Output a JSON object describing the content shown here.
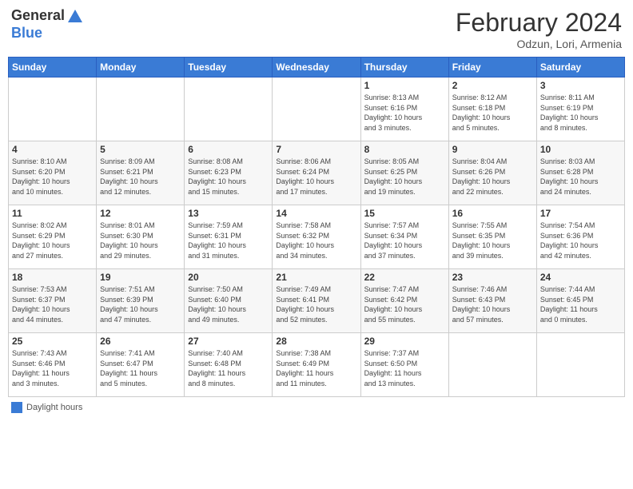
{
  "header": {
    "logo_general": "General",
    "logo_blue": "Blue",
    "title": "February 2024",
    "subtitle": "Odzun, Lori, Armenia"
  },
  "legend": {
    "box_label": "Daylight hours"
  },
  "days_of_week": [
    "Sunday",
    "Monday",
    "Tuesday",
    "Wednesday",
    "Thursday",
    "Friday",
    "Saturday"
  ],
  "weeks": [
    [
      {
        "day": "",
        "info": ""
      },
      {
        "day": "",
        "info": ""
      },
      {
        "day": "",
        "info": ""
      },
      {
        "day": "",
        "info": ""
      },
      {
        "day": "1",
        "info": "Sunrise: 8:13 AM\nSunset: 6:16 PM\nDaylight: 10 hours\nand 3 minutes."
      },
      {
        "day": "2",
        "info": "Sunrise: 8:12 AM\nSunset: 6:18 PM\nDaylight: 10 hours\nand 5 minutes."
      },
      {
        "day": "3",
        "info": "Sunrise: 8:11 AM\nSunset: 6:19 PM\nDaylight: 10 hours\nand 8 minutes."
      }
    ],
    [
      {
        "day": "4",
        "info": "Sunrise: 8:10 AM\nSunset: 6:20 PM\nDaylight: 10 hours\nand 10 minutes."
      },
      {
        "day": "5",
        "info": "Sunrise: 8:09 AM\nSunset: 6:21 PM\nDaylight: 10 hours\nand 12 minutes."
      },
      {
        "day": "6",
        "info": "Sunrise: 8:08 AM\nSunset: 6:23 PM\nDaylight: 10 hours\nand 15 minutes."
      },
      {
        "day": "7",
        "info": "Sunrise: 8:06 AM\nSunset: 6:24 PM\nDaylight: 10 hours\nand 17 minutes."
      },
      {
        "day": "8",
        "info": "Sunrise: 8:05 AM\nSunset: 6:25 PM\nDaylight: 10 hours\nand 19 minutes."
      },
      {
        "day": "9",
        "info": "Sunrise: 8:04 AM\nSunset: 6:26 PM\nDaylight: 10 hours\nand 22 minutes."
      },
      {
        "day": "10",
        "info": "Sunrise: 8:03 AM\nSunset: 6:28 PM\nDaylight: 10 hours\nand 24 minutes."
      }
    ],
    [
      {
        "day": "11",
        "info": "Sunrise: 8:02 AM\nSunset: 6:29 PM\nDaylight: 10 hours\nand 27 minutes."
      },
      {
        "day": "12",
        "info": "Sunrise: 8:01 AM\nSunset: 6:30 PM\nDaylight: 10 hours\nand 29 minutes."
      },
      {
        "day": "13",
        "info": "Sunrise: 7:59 AM\nSunset: 6:31 PM\nDaylight: 10 hours\nand 31 minutes."
      },
      {
        "day": "14",
        "info": "Sunrise: 7:58 AM\nSunset: 6:32 PM\nDaylight: 10 hours\nand 34 minutes."
      },
      {
        "day": "15",
        "info": "Sunrise: 7:57 AM\nSunset: 6:34 PM\nDaylight: 10 hours\nand 37 minutes."
      },
      {
        "day": "16",
        "info": "Sunrise: 7:55 AM\nSunset: 6:35 PM\nDaylight: 10 hours\nand 39 minutes."
      },
      {
        "day": "17",
        "info": "Sunrise: 7:54 AM\nSunset: 6:36 PM\nDaylight: 10 hours\nand 42 minutes."
      }
    ],
    [
      {
        "day": "18",
        "info": "Sunrise: 7:53 AM\nSunset: 6:37 PM\nDaylight: 10 hours\nand 44 minutes."
      },
      {
        "day": "19",
        "info": "Sunrise: 7:51 AM\nSunset: 6:39 PM\nDaylight: 10 hours\nand 47 minutes."
      },
      {
        "day": "20",
        "info": "Sunrise: 7:50 AM\nSunset: 6:40 PM\nDaylight: 10 hours\nand 49 minutes."
      },
      {
        "day": "21",
        "info": "Sunrise: 7:49 AM\nSunset: 6:41 PM\nDaylight: 10 hours\nand 52 minutes."
      },
      {
        "day": "22",
        "info": "Sunrise: 7:47 AM\nSunset: 6:42 PM\nDaylight: 10 hours\nand 55 minutes."
      },
      {
        "day": "23",
        "info": "Sunrise: 7:46 AM\nSunset: 6:43 PM\nDaylight: 10 hours\nand 57 minutes."
      },
      {
        "day": "24",
        "info": "Sunrise: 7:44 AM\nSunset: 6:45 PM\nDaylight: 11 hours\nand 0 minutes."
      }
    ],
    [
      {
        "day": "25",
        "info": "Sunrise: 7:43 AM\nSunset: 6:46 PM\nDaylight: 11 hours\nand 3 minutes."
      },
      {
        "day": "26",
        "info": "Sunrise: 7:41 AM\nSunset: 6:47 PM\nDaylight: 11 hours\nand 5 minutes."
      },
      {
        "day": "27",
        "info": "Sunrise: 7:40 AM\nSunset: 6:48 PM\nDaylight: 11 hours\nand 8 minutes."
      },
      {
        "day": "28",
        "info": "Sunrise: 7:38 AM\nSunset: 6:49 PM\nDaylight: 11 hours\nand 11 minutes."
      },
      {
        "day": "29",
        "info": "Sunrise: 7:37 AM\nSunset: 6:50 PM\nDaylight: 11 hours\nand 13 minutes."
      },
      {
        "day": "",
        "info": ""
      },
      {
        "day": "",
        "info": ""
      }
    ]
  ]
}
